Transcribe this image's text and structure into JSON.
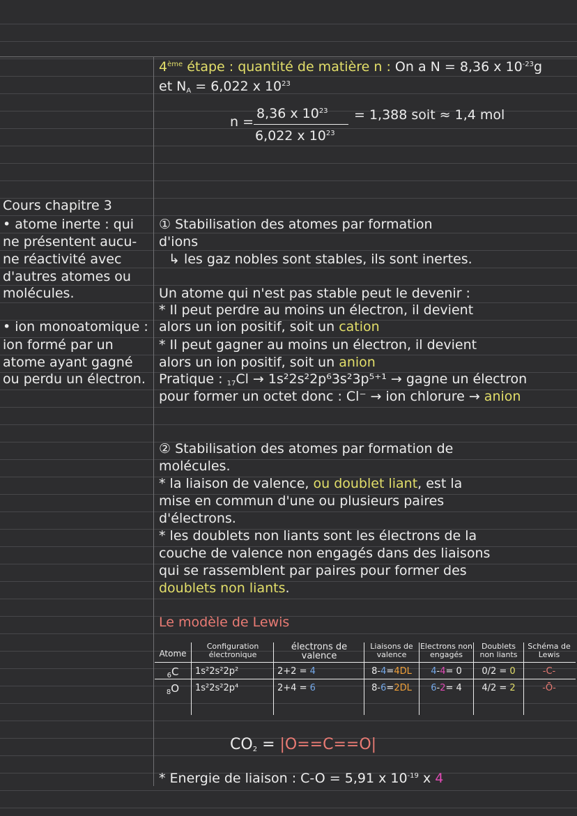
{
  "step4": {
    "title_num": "4",
    "title_sup": "ème",
    "title_text": "étape : quantité de matière n :",
    "line1_rest": "On a N = 8,36 x 10",
    "line1_exp": "-23",
    "line1_unit": "g",
    "line2_prefix": "et N",
    "line2_sub": "A",
    "line2_rest": "= 6,022 x 10",
    "line2_exp": "23",
    "frac_lhs": "n =",
    "frac_num": "8,36 x 10",
    "frac_num_exp": "23",
    "frac_den": "6,022 x 10",
    "frac_den_exp": "23",
    "frac_result": "= 1,388 soit ≈ 1,4 mol"
  },
  "sidebar": {
    "heading": "Cours chapitre 3",
    "def1": [
      "• atome inerte : qui",
      "ne présentent aucu-",
      "ne réactivité avec",
      "d'autres atomes ou",
      "molécules."
    ],
    "def2": [
      "• ion monoatomique :",
      "ion formé par un",
      "atome ayant gagné",
      "ou perdu un électron."
    ]
  },
  "section1": {
    "title": "① Stabilisation des atomes par formation",
    "title2": "d'ions",
    "arrow_line": "↳ les gaz nobles sont stables, ils sont inertes.",
    "p1": "Un atome qui n'est pas stable peut le devenir :",
    "b1_l1": "* Il peut perdre au moins un électron, il devient",
    "b1_l2_pre": "alors un ion positif, soit un",
    "b1_l2_word": "cation",
    "b2_l1": "* Il peut gagner au moins un électron, il devient",
    "b2_l2_pre": "alors un ion positif, soit un",
    "b2_l2_word": "anion",
    "practice_pre": "Pratique :",
    "practice_num": "17",
    "practice_formula": "Cl → 1s²2s²2p⁶3s²3p⁵⁺¹ → gagne un électron",
    "practice_l2_pre": "pour former un octet donc : Cl⁻ → ion chlorure →",
    "practice_l2_word": "anion"
  },
  "section2": {
    "title": "② Stabilisation des atomes par formation de",
    "title2": "molécules.",
    "b1_l1_pre": "* la liaison de valence,",
    "b1_l1_hl": "ou doublet liant",
    "b1_l1_post": ", est la",
    "b1_l2": "mise en commun d'une ou plusieurs paires",
    "b1_l3": "d'électrons.",
    "b2_l1": "* les doublets non liants sont les électrons de la",
    "b2_l2": "couche de valence non engagés dans des liaisons",
    "b2_l3": "qui se rassemblent par paires pour former des",
    "b2_l4": "doublets non liants",
    "b2_l4_end": "."
  },
  "lewis": {
    "heading": "Le modèle de Lewis",
    "headers": [
      "Atome",
      "Configuration électronique",
      "électrons de valence",
      "Liaisons de valence",
      "Electrons non engagés",
      "Doublets non liants",
      "Schéma de Lewis"
    ],
    "rows": [
      {
        "atom_z": "6",
        "atom": "C",
        "config": "1s²2s²2p²",
        "valence_pre": "2+2 =",
        "valence_val": "4",
        "liaisons_pre": "8-",
        "liaisons_a": "4",
        "liaisons_mid": "=",
        "liaisons_b": "4DL",
        "engages_a": "4",
        "engages_mid": "-",
        "engages_b": "4",
        "engages_post": "= 0",
        "doublets_pre": "0/2 =",
        "doublets_val": "0",
        "schema": "-C-"
      },
      {
        "atom_z": "8",
        "atom": "O",
        "config": "1s²2s²2p⁴",
        "valence_pre": "2+4 =",
        "valence_val": "6",
        "liaisons_pre": "8-",
        "liaisons_a": "6",
        "liaisons_mid": "=",
        "liaisons_b": "2DL",
        "engages_a": "6",
        "engages_mid": "-",
        "engages_b": "2",
        "engages_post": "= 4",
        "doublets_pre": "4/2 =",
        "doublets_val": "2",
        "schema": "-Ō-"
      }
    ]
  },
  "co2": {
    "lhs": "CO",
    "lhs_sub": "2",
    "eq": "=",
    "o1": "|O",
    "bond1": "==",
    "c": "C",
    "bond2": "==",
    "o2": "O|"
  },
  "energy": {
    "text": "* Energie de liaison : C-O = 5,91 x 10",
    "exp": "-19",
    "times": "x",
    "factor": "4"
  },
  "colors": {
    "background": "#2d2d2f",
    "text": "#ececec",
    "yellow": "#e3df6a",
    "pink": "#e97b74",
    "blue": "#74a8e8",
    "magenta": "#e04bb5",
    "orange": "#f1a13a"
  }
}
